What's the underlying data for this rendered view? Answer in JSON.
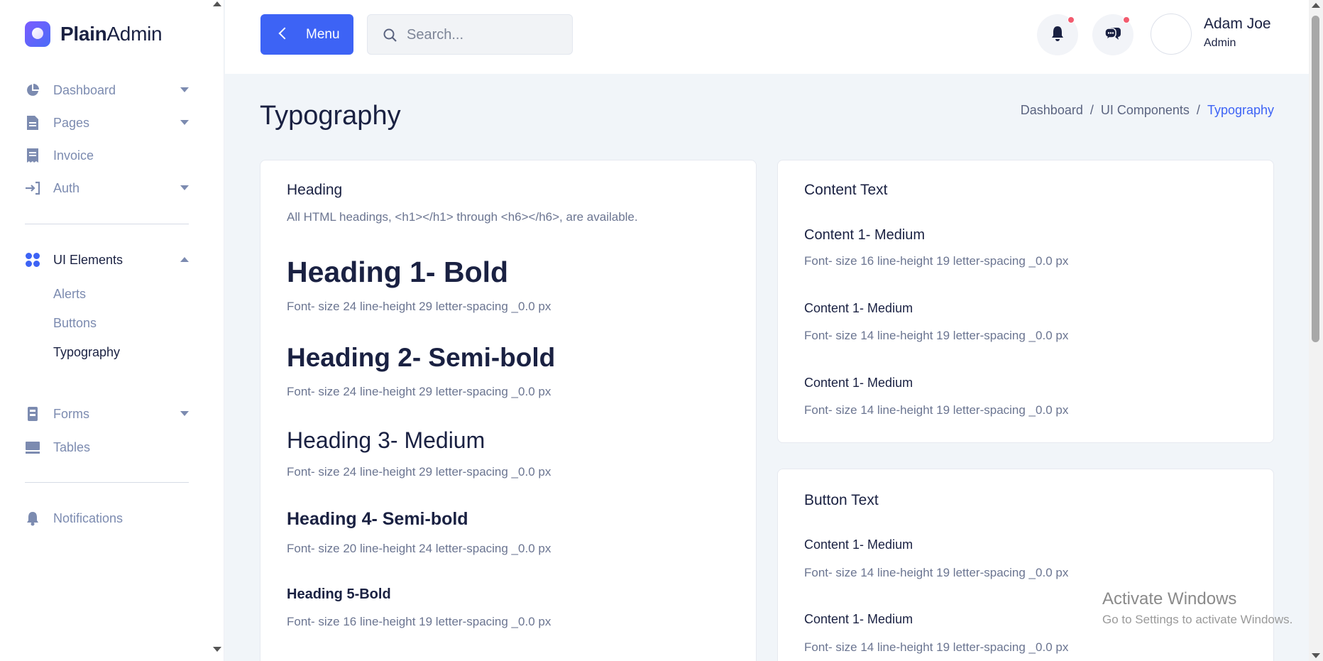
{
  "app": {
    "logo_bold": "Plain",
    "logo_rest": "Admin"
  },
  "sidebar": {
    "items": [
      {
        "label": "Dashboard",
        "icon": "pie-chart-icon",
        "caret": "down"
      },
      {
        "label": "Pages",
        "icon": "document-icon",
        "caret": "down"
      },
      {
        "label": "Invoice",
        "icon": "receipt-icon"
      },
      {
        "label": "Auth",
        "icon": "login-arrow-icon",
        "caret": "down"
      },
      {
        "label": "UI Elements",
        "icon": "grid-dots-icon",
        "caret": "up",
        "active": true
      },
      {
        "label": "Forms",
        "icon": "form-icon",
        "caret": "down"
      },
      {
        "label": "Tables",
        "icon": "table-icon"
      },
      {
        "label": "Notifications",
        "icon": "bell-icon"
      }
    ],
    "sub_items": [
      "Alerts",
      "Buttons",
      "Typography"
    ],
    "active_sub": "Typography"
  },
  "header": {
    "menu_label": "Menu",
    "search_placeholder": "Search...",
    "user_name": "Adam Joe",
    "user_role": "Admin"
  },
  "page": {
    "title": "Typography",
    "breadcrumb": [
      "Dashboard",
      "UI Components",
      "Typography"
    ],
    "sep": "/"
  },
  "heading_card": {
    "title": "Heading",
    "description": "All HTML headings, <h1></h1> through <h6></h6>, are available.",
    "samples": [
      {
        "label": "Heading 1- Bold",
        "spec": "Font- size 24 line-height 29 letter-spacing _0.0 px"
      },
      {
        "label": "Heading 2- Semi-bold",
        "spec": "Font- size 24 line-height 29 letter-spacing _0.0 px"
      },
      {
        "label": "Heading 3- Medium",
        "spec": "Font- size 24 line-height 29 letter-spacing _0.0 px"
      },
      {
        "label": "Heading 4- Semi-bold",
        "spec": "Font- size 20 line-height 24 letter-spacing _0.0 px"
      },
      {
        "label": "Heading 5-Bold",
        "spec": "Font- size 16 line-height 19 letter-spacing _0.0 px"
      }
    ]
  },
  "content_card": {
    "title": "Content Text",
    "samples": [
      {
        "label": "Content 1- Medium",
        "spec": "Font- size 16 line-height 19 letter-spacing _0.0 px"
      },
      {
        "label": "Content 1- Medium",
        "spec": "Font- size 14 line-height 19 letter-spacing _0.0 px"
      },
      {
        "label": "Content 1- Medium",
        "spec": "Font- size 14 line-height 19 letter-spacing _0.0 px"
      }
    ]
  },
  "button_card": {
    "title": "Button Text",
    "samples": [
      {
        "label": "Content 1- Medium",
        "spec": "Font- size 14 line-height 19 letter-spacing _0.0 px"
      },
      {
        "label": "Content 1- Medium",
        "spec": "Font- size 14 line-height 19 letter-spacing _0.0 px"
      }
    ]
  },
  "watermark": {
    "line1": "Activate Windows",
    "line2": "Go to Settings to activate Windows."
  },
  "colors": {
    "primary": "#3d63f5",
    "text": "#1a2142",
    "muted": "#7c8bb0",
    "badge": "#f25b6e"
  }
}
